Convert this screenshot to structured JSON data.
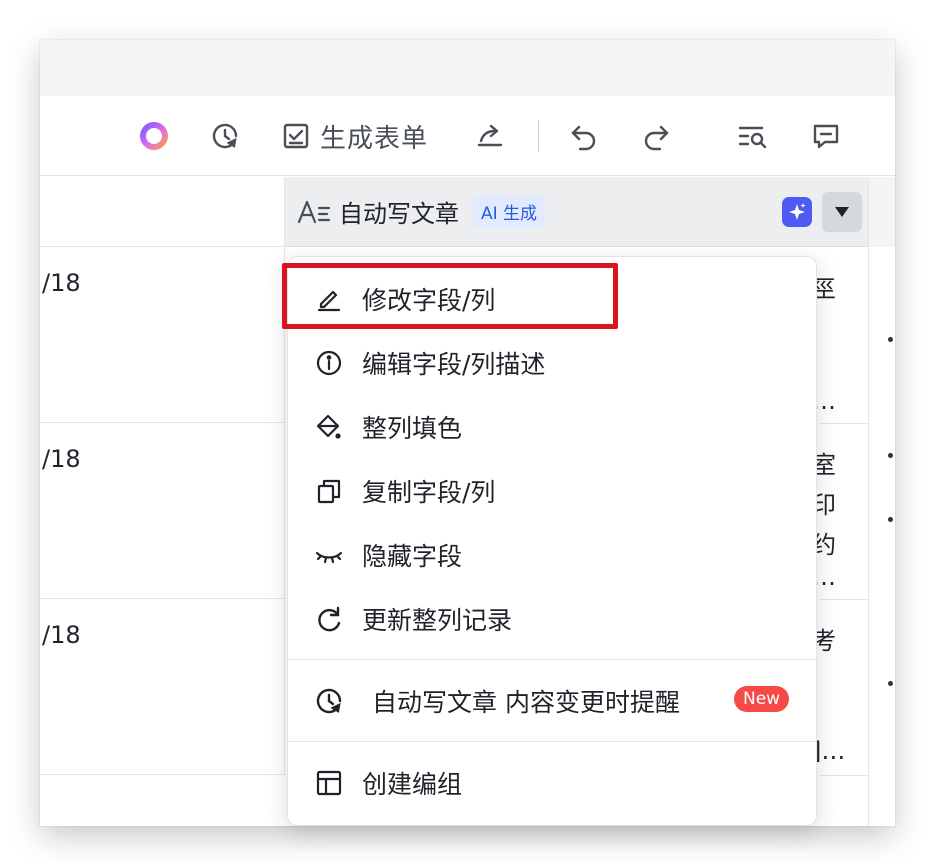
{
  "toolbar": {
    "form_label": "生成表单",
    "icons": [
      "ai-assistant-icon",
      "history-icon",
      "form-checkbox-icon",
      "share-icon",
      "undo-icon",
      "redo-icon",
      "find-icon",
      "comment-icon"
    ]
  },
  "field_header": {
    "name": "自动写文章",
    "badge": "AI 生成",
    "icon": "text-field-icon",
    "accent_color": "#4e5bf2"
  },
  "rows": [
    {
      "date": "/18",
      "peek": [
        "巠",
        "…"
      ]
    },
    {
      "date": "/18",
      "peek": [
        "室",
        "印",
        "约",
        "…"
      ]
    },
    {
      "date": "/18",
      "peek": [
        "考",
        "]…"
      ]
    }
  ],
  "menu": {
    "items": [
      {
        "label": "修改字段/列",
        "icon": "edit-pencil-icon"
      },
      {
        "label": "编辑字段/列描述",
        "icon": "info-circle-icon"
      },
      {
        "label": "整列填色",
        "icon": "paint-bucket-icon"
      },
      {
        "label": "复制字段/列",
        "icon": "copy-icon"
      },
      {
        "label": "隐藏字段",
        "icon": "eye-closed-icon"
      },
      {
        "label": "更新整列记录",
        "icon": "refresh-icon"
      },
      {
        "label": "自动写文章 内容变更时提醒",
        "icon": "clock-reminder-icon",
        "badge": "New"
      },
      {
        "label": "创建编组",
        "icon": "group-layout-icon"
      }
    ],
    "highlight_color": "#d9141f",
    "new_badge_color": "#f54a45"
  }
}
